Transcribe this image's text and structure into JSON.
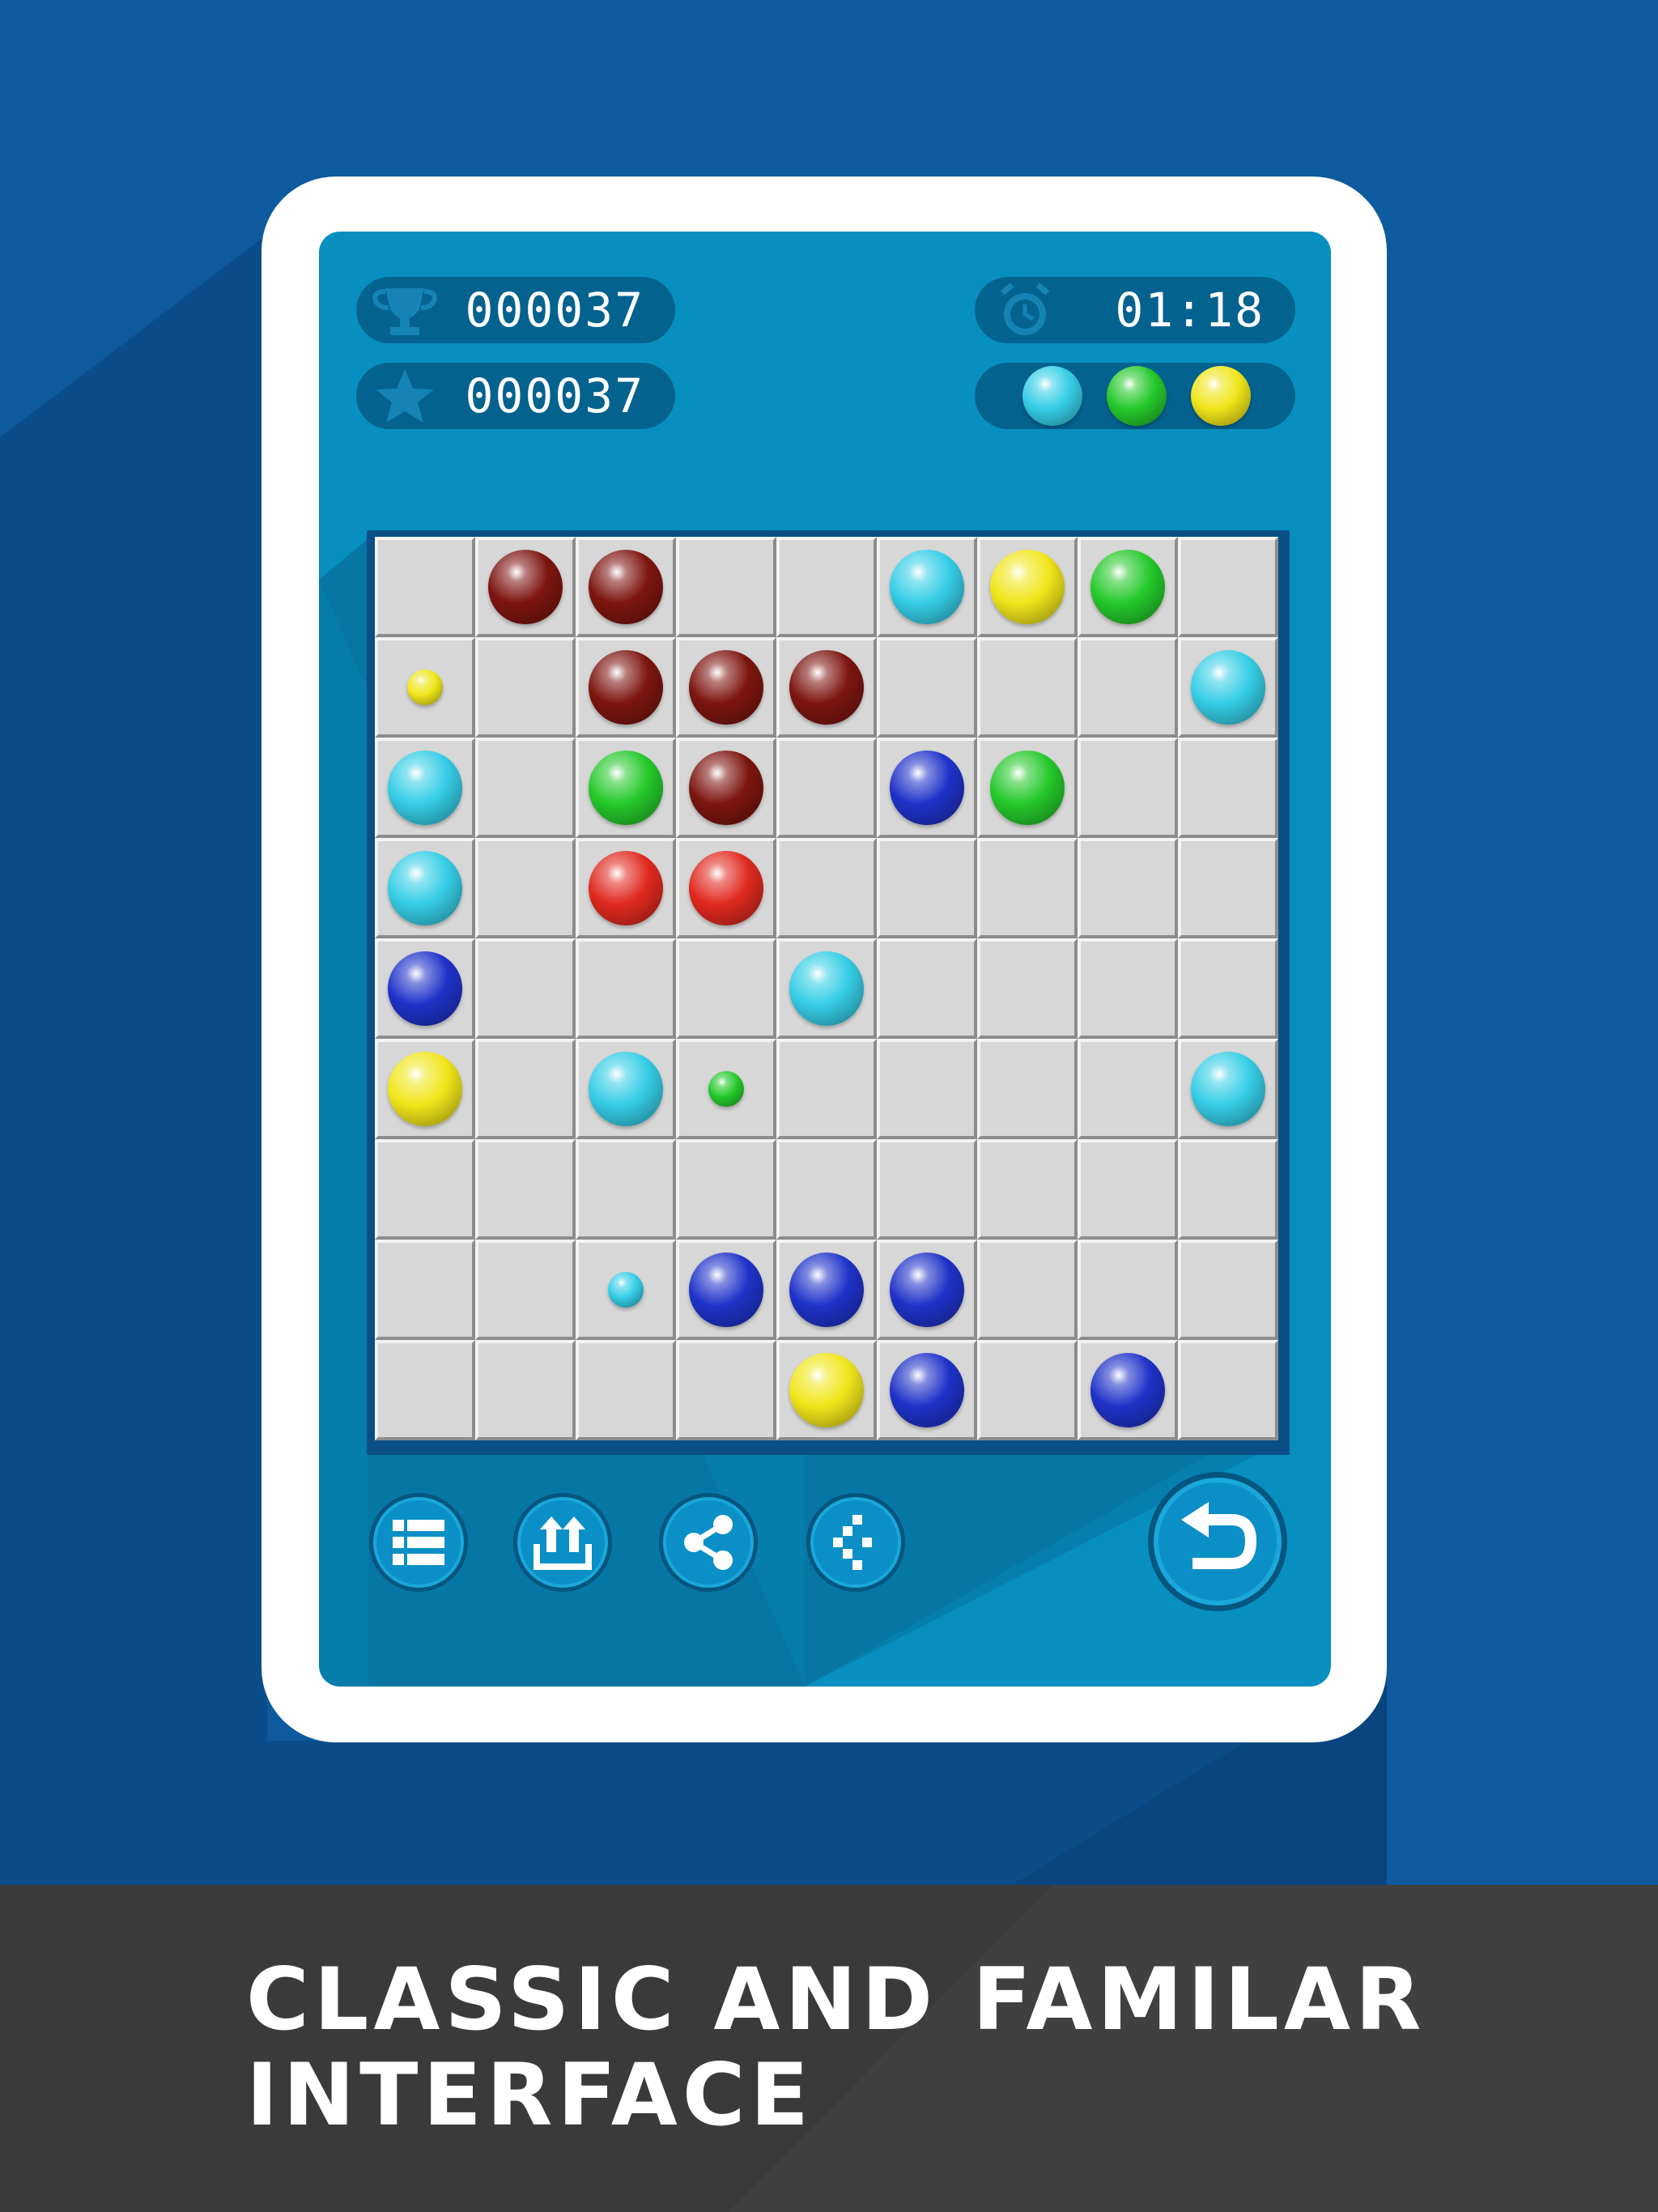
{
  "hud": {
    "best_score": "000037",
    "score": "000037",
    "timer": "01:18",
    "trophy_icon": "trophy-icon",
    "star_icon": "star-icon",
    "clock_icon": "alarm-clock-icon",
    "next_balls": [
      "cyan",
      "green",
      "yellow"
    ]
  },
  "ball_colors": {
    "red": "#e0291f",
    "darkred": "#7d1510",
    "cyan": "#35cde6",
    "yellow": "#f0e51a",
    "green": "#25c92b",
    "blue": "#1f32c9"
  },
  "board": {
    "rows": 9,
    "cols": 9,
    "balls": [
      {
        "r": 0,
        "c": 1,
        "color": "darkred",
        "size": "full"
      },
      {
        "r": 0,
        "c": 2,
        "color": "darkred",
        "size": "full"
      },
      {
        "r": 0,
        "c": 5,
        "color": "cyan",
        "size": "full"
      },
      {
        "r": 0,
        "c": 6,
        "color": "yellow",
        "size": "full"
      },
      {
        "r": 0,
        "c": 7,
        "color": "green",
        "size": "full"
      },
      {
        "r": 1,
        "c": 0,
        "color": "yellow",
        "size": "small"
      },
      {
        "r": 1,
        "c": 2,
        "color": "darkred",
        "size": "full"
      },
      {
        "r": 1,
        "c": 3,
        "color": "darkred",
        "size": "full"
      },
      {
        "r": 1,
        "c": 4,
        "color": "darkred",
        "size": "full"
      },
      {
        "r": 1,
        "c": 8,
        "color": "cyan",
        "size": "full"
      },
      {
        "r": 2,
        "c": 0,
        "color": "cyan",
        "size": "full"
      },
      {
        "r": 2,
        "c": 2,
        "color": "green",
        "size": "full"
      },
      {
        "r": 2,
        "c": 3,
        "color": "darkred",
        "size": "full"
      },
      {
        "r": 2,
        "c": 5,
        "color": "blue",
        "size": "full"
      },
      {
        "r": 2,
        "c": 6,
        "color": "green",
        "size": "full"
      },
      {
        "r": 3,
        "c": 0,
        "color": "cyan",
        "size": "full"
      },
      {
        "r": 3,
        "c": 2,
        "color": "red",
        "size": "full"
      },
      {
        "r": 3,
        "c": 3,
        "color": "red",
        "size": "full"
      },
      {
        "r": 4,
        "c": 0,
        "color": "blue",
        "size": "full"
      },
      {
        "r": 4,
        "c": 4,
        "color": "cyan",
        "size": "full"
      },
      {
        "r": 5,
        "c": 0,
        "color": "yellow",
        "size": "full"
      },
      {
        "r": 5,
        "c": 2,
        "color": "cyan",
        "size": "full"
      },
      {
        "r": 5,
        "c": 3,
        "color": "green",
        "size": "small"
      },
      {
        "r": 5,
        "c": 8,
        "color": "cyan",
        "size": "full"
      },
      {
        "r": 7,
        "c": 2,
        "color": "cyan",
        "size": "small"
      },
      {
        "r": 7,
        "c": 3,
        "color": "blue",
        "size": "full"
      },
      {
        "r": 7,
        "c": 4,
        "color": "blue",
        "size": "full"
      },
      {
        "r": 7,
        "c": 5,
        "color": "blue",
        "size": "full"
      },
      {
        "r": 8,
        "c": 4,
        "color": "yellow",
        "size": "full"
      },
      {
        "r": 8,
        "c": 5,
        "color": "blue",
        "size": "full"
      },
      {
        "r": 8,
        "c": 7,
        "color": "blue",
        "size": "full"
      }
    ]
  },
  "toolbar": {
    "buttons": [
      "menu-icon",
      "upload-icon",
      "share-icon",
      "more-icon"
    ],
    "undo": "undo-icon"
  },
  "banner": {
    "line1": "CLASSIC AND FAMILAR",
    "line2": "INTERFACE"
  }
}
